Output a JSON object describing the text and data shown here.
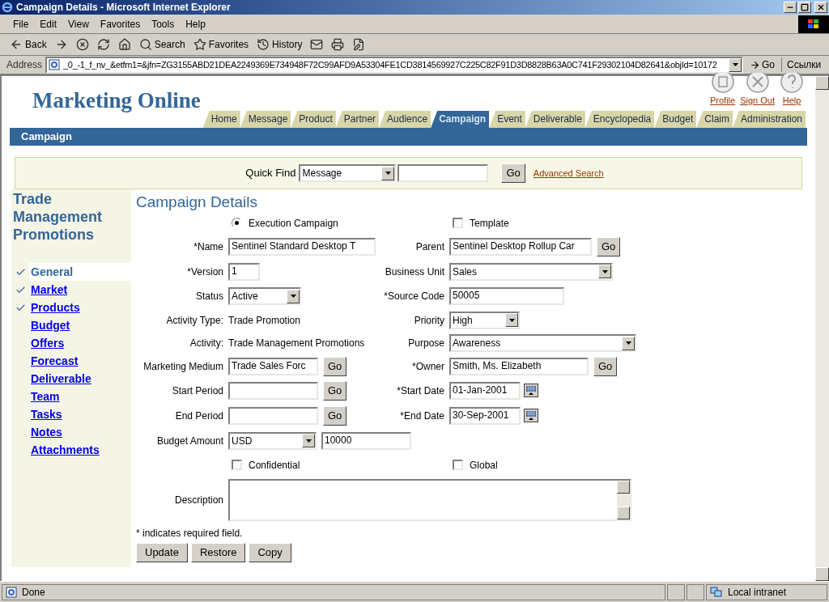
{
  "window": {
    "title": "Campaign Details - Microsoft Internet Explorer"
  },
  "menu": [
    "File",
    "Edit",
    "View",
    "Favorites",
    "Tools",
    "Help"
  ],
  "toolbar": [
    {
      "kind": "back",
      "label": "Back"
    },
    {
      "kind": "forward"
    },
    {
      "kind": "stop"
    },
    {
      "kind": "refresh"
    },
    {
      "kind": "home"
    },
    {
      "kind": "search",
      "label": "Search"
    },
    {
      "kind": "favorites",
      "label": "Favorites"
    },
    {
      "kind": "history",
      "label": "History"
    },
    {
      "kind": "mail"
    },
    {
      "kind": "print"
    },
    {
      "kind": "edit"
    }
  ],
  "address": {
    "label": "Address",
    "value": "_0_-1_f_nv_&etfm1=&jfn=ZG3155ABD21DEA2249369E734948F72C99AFD9A53304FE1CD3814569927C225C82F91D3D8828B63A0C741F29302104D82641&objId=10172",
    "go": "Go",
    "links": "Ссылки"
  },
  "app": {
    "logo": "Marketing Online",
    "header_links": [
      "Profile",
      "Sign Out",
      "Help"
    ],
    "tabs": [
      {
        "label": "Home",
        "selected": false
      },
      {
        "label": "Message",
        "selected": false
      },
      {
        "label": "Product",
        "selected": false
      },
      {
        "label": "Partner",
        "selected": false
      },
      {
        "label": "Audience",
        "selected": false
      },
      {
        "label": "Campaign",
        "selected": true
      },
      {
        "label": "Event",
        "selected": false
      },
      {
        "label": "Deliverable",
        "selected": false
      },
      {
        "label": "Encyclopedia",
        "selected": false
      },
      {
        "label": "Budget",
        "selected": false
      },
      {
        "label": "Claim",
        "selected": false
      },
      {
        "label": "Administration",
        "selected": false
      }
    ],
    "section": "Campaign",
    "quick_find": {
      "label": "Quick Find",
      "value": "Message",
      "button": "Go",
      "link": "Advanced Search"
    }
  },
  "sidebar": {
    "title": "Trade Management Promotions",
    "items": [
      {
        "label": "General",
        "checked": true,
        "selected": true
      },
      {
        "label": "Market",
        "checked": true,
        "selected": false
      },
      {
        "label": "Products",
        "checked": true,
        "selected": false
      },
      {
        "label": "Budget",
        "checked": false,
        "selected": false
      },
      {
        "label": "Offers",
        "checked": false,
        "selected": false
      },
      {
        "label": "Forecast",
        "checked": false,
        "selected": false
      },
      {
        "label": "Deliverable",
        "checked": false,
        "selected": false
      },
      {
        "label": "Team",
        "checked": false,
        "selected": false
      },
      {
        "label": "Tasks",
        "checked": false,
        "selected": false
      },
      {
        "label": "Notes",
        "checked": false,
        "selected": false
      },
      {
        "label": "Attachments",
        "checked": false,
        "selected": false
      }
    ]
  },
  "form": {
    "title": "Campaign Details",
    "rows": [
      {
        "left": {
          "kind": "radio",
          "label": "Execution Campaign",
          "selected": true
        },
        "right": {
          "kind": "checkbox",
          "label": "Template",
          "checked": false
        }
      },
      {
        "left": {
          "kind": "text",
          "label": "*Name",
          "value": "Sentinel Standard Desktop T"
        },
        "right": {
          "kind": "lookup",
          "label": "Parent",
          "value": "Sentinel Desktop Rollup Car",
          "button": "Go"
        }
      },
      {
        "left": {
          "kind": "text",
          "label": "*Version",
          "value": "1"
        },
        "right": {
          "kind": "select",
          "label": "Business Unit",
          "value": "Sales"
        }
      },
      {
        "left": {
          "kind": "select",
          "label": "Status",
          "value": "Active"
        },
        "right": {
          "kind": "text",
          "label": "*Source Code",
          "value": "50005"
        }
      },
      {
        "left": {
          "kind": "static",
          "label": "Activity Type:",
          "value": "Trade Promotion"
        },
        "right": {
          "kind": "select",
          "label": "Priority",
          "value": "High"
        }
      },
      {
        "left": {
          "kind": "static",
          "label": "Activity:",
          "value": "Trade Management Promotions"
        },
        "right": {
          "kind": "select",
          "label": "Purpose",
          "value": "Awareness"
        }
      },
      {
        "left": {
          "kind": "lookup",
          "label": "Marketing Medium",
          "value": "Trade Sales Forc",
          "button": "Go"
        },
        "right": {
          "kind": "lookup",
          "label": "*Owner",
          "value": "Smith, Ms. Elizabeth",
          "button": "Go"
        }
      },
      {
        "left": {
          "kind": "lookup",
          "label": "Start Period",
          "button": "Go"
        },
        "right": {
          "kind": "date",
          "label": "*Start Date",
          "value": "01-Jan-2001"
        }
      },
      {
        "left": {
          "kind": "lookup",
          "label": "End Period",
          "button": "Go"
        },
        "right": {
          "kind": "date",
          "label": "*End Date",
          "value": "30-Sep-2001"
        }
      },
      {
        "left": {
          "kind": "amount",
          "label": "Budget Amount",
          "currency": "USD",
          "value": "10000"
        }
      },
      {
        "left": {
          "kind": "checkbox",
          "label": "Confidential",
          "checked": false
        },
        "right": {
          "kind": "checkbox",
          "label": "Global",
          "checked": false
        }
      },
      {
        "left": {
          "kind": "textarea",
          "label": "Description"
        }
      }
    ],
    "note": "* indicates required field.",
    "buttons": [
      "Update",
      "Restore",
      "Copy"
    ]
  },
  "status_bar": {
    "text": "Done",
    "zone": "Local intranet"
  }
}
